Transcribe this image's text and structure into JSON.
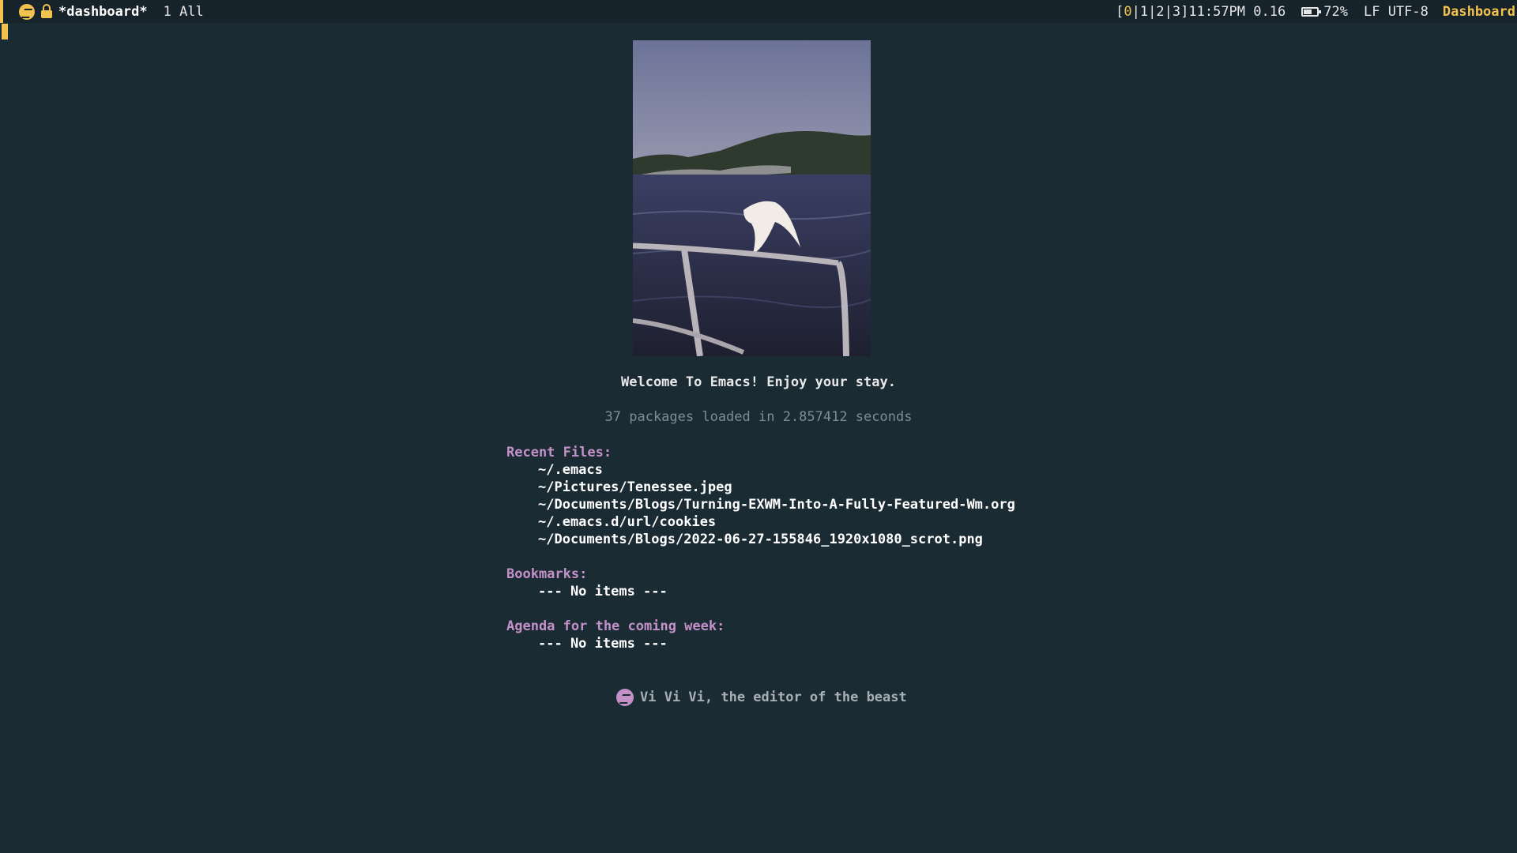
{
  "modeline": {
    "buffer_name": "*dashboard*",
    "position": "1 All",
    "workspaces": {
      "open": "[",
      "active": "0",
      "sep1": "|",
      "ws1": "1",
      "sep2": "|",
      "ws2": "2",
      "sep3": "|",
      "ws3": "3",
      "close": "]"
    },
    "time": "11:57PM",
    "load": "0.16",
    "battery_percent": "72%",
    "battery_level": 0.72,
    "eol": "LF",
    "encoding": "UTF-8",
    "major_mode": "Dashboard",
    "icons": {
      "emacs": "emacs-icon",
      "lock": "lock-icon",
      "battery": "battery-icon"
    }
  },
  "dashboard": {
    "welcome": "Welcome To Emacs! Enjoy your stay.",
    "init_info": "37 packages loaded in 2.857412 seconds",
    "sections": {
      "recent": {
        "title": "Recent Files:",
        "items": [
          "~/.emacs",
          "~/Pictures/Tenessee.jpeg",
          "~/Documents/Blogs/Turning-EXWM-Into-A-Fully-Featured-Wm.org",
          "~/.emacs.d/url/cookies",
          "~/Documents/Blogs/2022-06-27-155846_1920x1080_scrot.png"
        ]
      },
      "bookmarks": {
        "title": "Bookmarks:",
        "items": [
          "--- No items ---"
        ]
      },
      "agenda": {
        "title": "Agenda for the coming week:",
        "items": [
          "--- No items ---"
        ]
      }
    },
    "footer": "Vi Vi Vi, the editor of the beast"
  },
  "colors": {
    "background": "#1b2b34",
    "modeline_bg": "#16232b",
    "accent_yellow": "#f2c14e",
    "section_title": "#c391c8",
    "muted": "#7f8c93"
  }
}
